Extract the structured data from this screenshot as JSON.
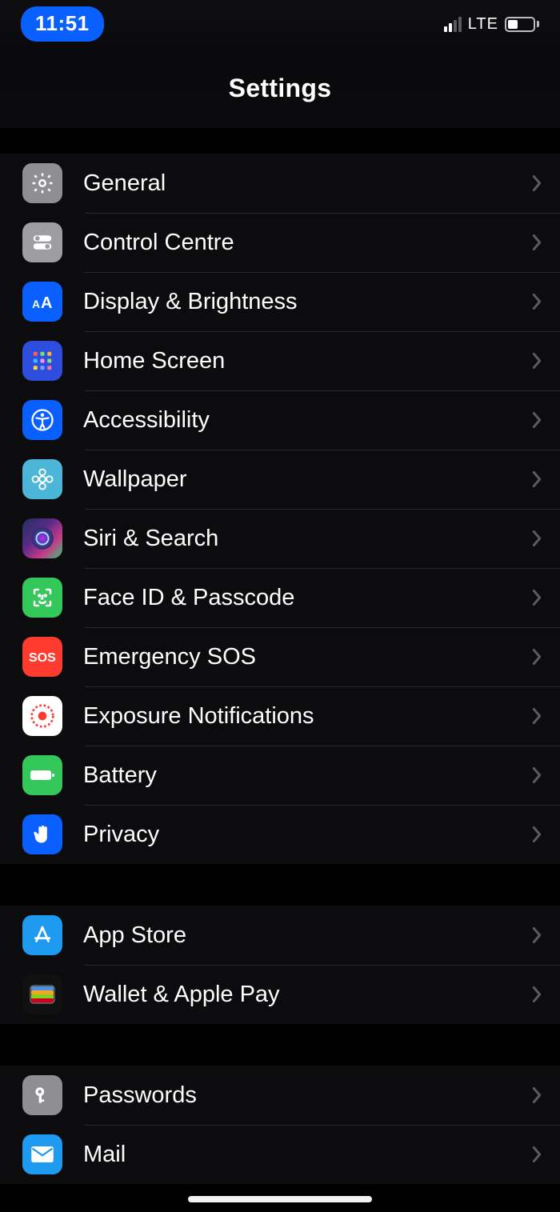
{
  "statusbar": {
    "time": "11:51",
    "network": "LTE"
  },
  "header": {
    "title": "Settings"
  },
  "groups": [
    {
      "items": [
        {
          "id": "general",
          "label": "General",
          "icon": "gear-icon",
          "bg": "bg-gray"
        },
        {
          "id": "control-centre",
          "label": "Control Centre",
          "icon": "toggles-icon",
          "bg": "bg-lgray"
        },
        {
          "id": "display-brightness",
          "label": "Display & Brightness",
          "icon": "text-size-icon",
          "bg": "bg-blue"
        },
        {
          "id": "home-screen",
          "label": "Home Screen",
          "icon": "app-grid-icon",
          "bg": "bg-indigo"
        },
        {
          "id": "accessibility",
          "label": "Accessibility",
          "icon": "accessibility-icon",
          "bg": "bg-blue"
        },
        {
          "id": "wallpaper",
          "label": "Wallpaper",
          "icon": "flower-icon",
          "bg": "bg-cyan"
        },
        {
          "id": "siri",
          "label": "Siri & Search",
          "icon": "siri-icon",
          "bg": "bg-siri"
        },
        {
          "id": "faceid",
          "label": "Face ID & Passcode",
          "icon": "faceid-icon",
          "bg": "bg-green"
        },
        {
          "id": "sos",
          "label": "Emergency SOS",
          "icon": "sos-icon",
          "bg": "bg-red"
        },
        {
          "id": "exposure",
          "label": "Exposure Notifications",
          "icon": "exposure-icon",
          "bg": "bg-white"
        },
        {
          "id": "battery",
          "label": "Battery",
          "icon": "battery-icon",
          "bg": "bg-green"
        },
        {
          "id": "privacy",
          "label": "Privacy",
          "icon": "hand-icon",
          "bg": "bg-blue"
        }
      ]
    },
    {
      "items": [
        {
          "id": "app-store",
          "label": "App Store",
          "icon": "appstore-icon",
          "bg": "bg-sky"
        },
        {
          "id": "wallet",
          "label": "Wallet & Apple Pay",
          "icon": "wallet-icon",
          "bg": "bg-wallet"
        }
      ]
    },
    {
      "items": [
        {
          "id": "passwords",
          "label": "Passwords",
          "icon": "key-icon",
          "bg": "bg-gray"
        },
        {
          "id": "mail",
          "label": "Mail",
          "icon": "mail-icon",
          "bg": "bg-mail"
        }
      ]
    }
  ]
}
